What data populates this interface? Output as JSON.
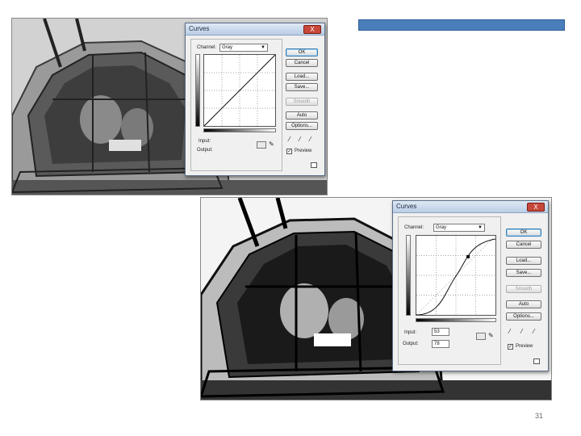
{
  "slide": {
    "page_number": "31"
  },
  "dialog_before": {
    "title": "Curves",
    "close_label": "X",
    "channel_label": "Channel:",
    "channel_value": "Gray",
    "buttons": {
      "ok": "OK",
      "cancel": "Cancel",
      "load": "Load...",
      "save": "Save...",
      "smooth": "Smooth",
      "auto": "Auto",
      "options": "Options..."
    },
    "input_label": "Input:",
    "output_label": "Output:",
    "preview_label": "Preview",
    "preview_checked": "✓"
  },
  "dialog_after": {
    "title": "Curves",
    "close_label": "X",
    "channel_label": "Channel:",
    "channel_value": "Gray",
    "buttons": {
      "ok": "OK",
      "cancel": "Cancel",
      "load": "Load...",
      "save": "Save...",
      "smooth": "Smooth",
      "auto": "Auto",
      "options": "Options..."
    },
    "input_label": "Input:",
    "input_value": "53",
    "output_label": "Output:",
    "output_value": "78",
    "preview_label": "Preview",
    "preview_checked": "✓"
  }
}
